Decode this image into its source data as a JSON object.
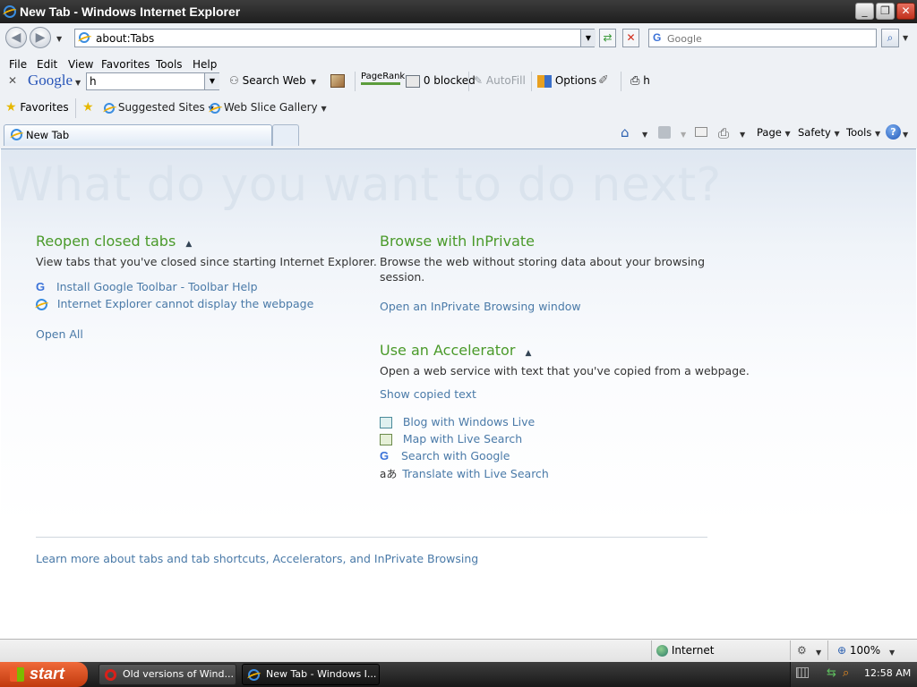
{
  "window": {
    "title": "New Tab - Windows Internet Explorer"
  },
  "window_controls": {
    "minimize": "_",
    "restore": "❐",
    "close": "✕"
  },
  "address_bar": {
    "url": "about:Tabs"
  },
  "search_box": {
    "placeholder": "Google"
  },
  "menu": [
    "File",
    "Edit",
    "View",
    "Favorites",
    "Tools",
    "Help"
  ],
  "google_toolbar": {
    "close": "✕",
    "brand": "Google",
    "search_value": "h",
    "search_web": "Search Web",
    "pagerank": "PageRank",
    "blocked": "0 blocked",
    "autofill": "AutoFill",
    "options": "Options",
    "highlight_term": "h"
  },
  "favorites_bar": {
    "favorites": "Favorites",
    "suggested_sites": "Suggested Sites",
    "web_slice_gallery": "Web Slice Gallery"
  },
  "tabs": {
    "active_label": "New Tab"
  },
  "command_bar": {
    "page": "Page",
    "safety": "Safety",
    "tools": "Tools"
  },
  "content": {
    "headline": "What do you want to do next?",
    "reopen": {
      "heading": "Reopen closed tabs",
      "description": "View tabs that you've closed since starting Internet Explorer.",
      "items": [
        "Install Google Toolbar - Toolbar Help",
        "Internet Explorer cannot display the webpage"
      ],
      "open_all": "Open All"
    },
    "inprivate": {
      "heading": "Browse with InPrivate",
      "description_line1": "Browse the web without storing data about your browsing",
      "description_line2": "session.",
      "link": "Open an InPrivate Browsing window"
    },
    "accelerator": {
      "heading": "Use an Accelerator",
      "description": "Open a web service with text that you've copied from a webpage.",
      "show_copied": "Show copied text",
      "items": [
        "Blog with Windows Live",
        "Map with Live Search",
        "Search with Google",
        "Translate with Live Search"
      ]
    },
    "learn_more": "Learn more about tabs and tab shortcuts, Accelerators, and InPrivate Browsing"
  },
  "status_bar": {
    "zone": "Internet",
    "zoom": "100%"
  },
  "taskbar": {
    "start": "start",
    "tasks": [
      "Old versions of Wind...",
      "New Tab - Windows I..."
    ],
    "clock": "12:58 AM"
  }
}
